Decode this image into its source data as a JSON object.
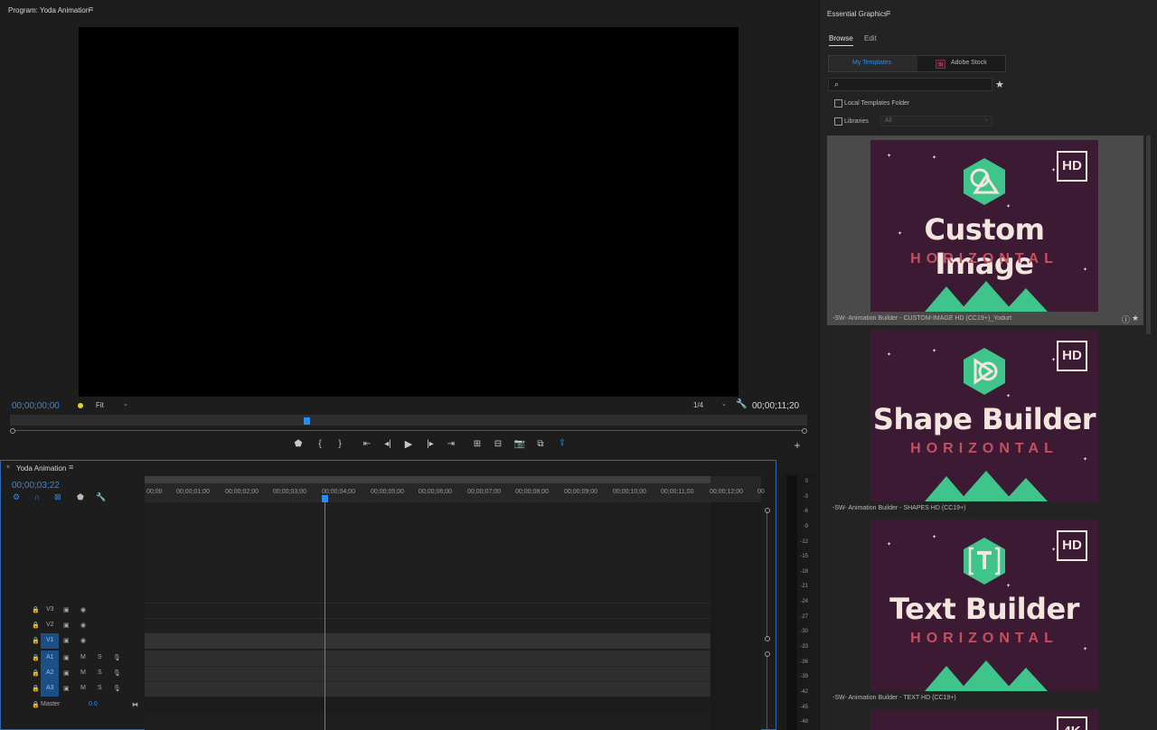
{
  "program_monitor": {
    "title": "Program: Yoda Animation",
    "timecode_left": "00;00;00;00",
    "fit": "Fit",
    "resolution": "1/4",
    "timecode_right": "00;00;11;20",
    "controls": [
      "marker-icon",
      "mark-in-icon",
      "mark-out-icon",
      "go-to-in-icon",
      "step-back-icon",
      "play-icon",
      "step-forward-icon",
      "go-to-out-icon",
      "lift-icon",
      "extract-icon",
      "export-frame-icon",
      "compare-icon",
      "export-icon",
      "add-icon"
    ]
  },
  "timeline": {
    "title": "Yoda Animation",
    "timecode": "00;00;03;22",
    "ruler": [
      "00;00",
      "00;00;01;00",
      "00;00;02;00",
      "00;00;03;00",
      "00;00;04;00",
      "00;00;05;00",
      "00;00;06;00",
      "00;00;07;00",
      "00;00;08;00",
      "00;00;09;00",
      "00;00;10;00",
      "00;00;11;00",
      "00;00;12;00",
      "00"
    ],
    "video_tracks": [
      {
        "label": "V3",
        "top": 0
      },
      {
        "label": "V2",
        "top": 0
      },
      {
        "label": "V1",
        "top": 0
      }
    ],
    "audio_tracks": [
      {
        "label": "A1",
        "m": "M",
        "s": "S"
      },
      {
        "label": "A2",
        "m": "M",
        "s": "S"
      },
      {
        "label": "A3",
        "m": "M",
        "s": "S"
      }
    ],
    "master_label": "Master",
    "master_value": "0.0"
  },
  "meter": {
    "labels": [
      "0",
      "-3",
      "-6",
      "-9",
      "-12",
      "-15",
      "-18",
      "-21",
      "-24",
      "-27",
      "-30",
      "-33",
      "-36",
      "-39",
      "-42",
      "-45",
      "-48"
    ]
  },
  "essential_graphics": {
    "title": "Essential Graphics",
    "tabs": [
      "Browse",
      "Edit"
    ],
    "source_tabs": [
      "My Templates",
      "Adobe Stock"
    ],
    "stock_badge": "St",
    "local_folder_label": "Local Templates Folder",
    "libraries_label": "Libraries",
    "libraries_value": "All",
    "templates": [
      {
        "title": "Custom Image",
        "subtitle": "HORIZONTAL",
        "badge": "HD",
        "label": "-SW- Animation Builder - CUSTOM-IMAGE HD (CC19+)_Yodurt"
      },
      {
        "title": "Shape Builder",
        "subtitle": "HORIZONTAL",
        "badge": "HD",
        "label": "-SW- Animation Builder - SHAPES HD (CC19+)"
      },
      {
        "title": "Text Builder",
        "subtitle": "HORIZONTAL",
        "badge": "HD",
        "label": "-SW- Animation Builder - TEXT HD (CC19+)"
      },
      {
        "title": "",
        "subtitle": "",
        "badge": "4K",
        "label": ""
      }
    ]
  },
  "colors": {
    "accent_blue": "#2d8ceb",
    "thumb_bg": "#3c1a33",
    "hex_green": "#3fc48b",
    "subtitle_red": "#c84e61"
  }
}
